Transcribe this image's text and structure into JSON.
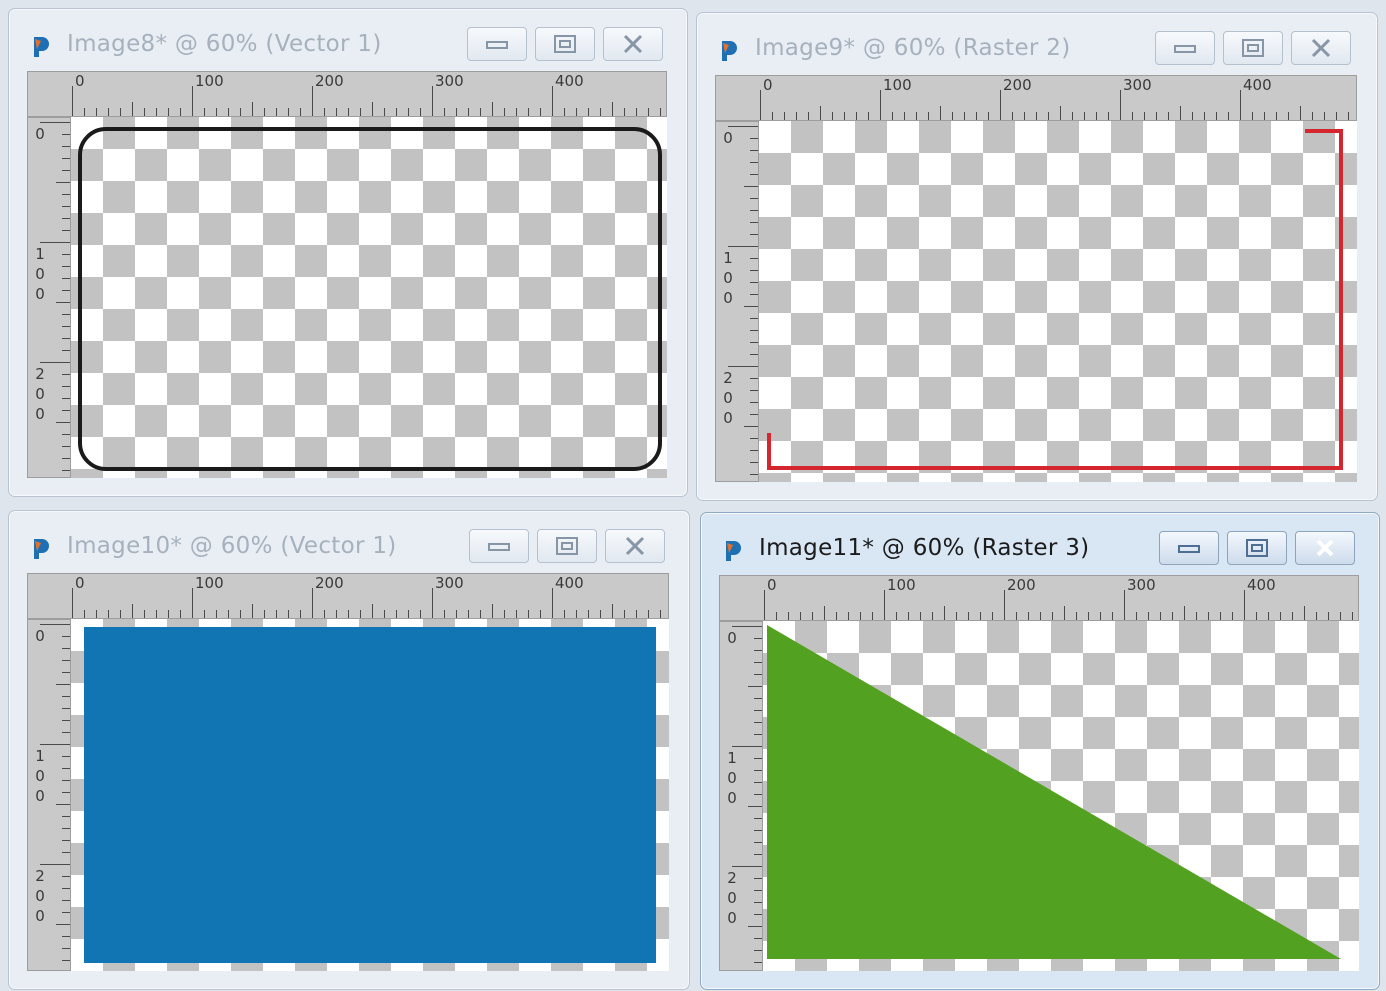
{
  "ruler": {
    "h_labels": [
      "0",
      "100",
      "200",
      "300",
      "400"
    ],
    "v_labels": [
      "0",
      "100",
      "200"
    ]
  },
  "windows": [
    {
      "title": "Image8* @ 60% (Vector 1)",
      "active": false,
      "content": "rounded-rectangle-outline",
      "color": "#1a1a1a"
    },
    {
      "title": "Image9* @ 60% (Raster 2)",
      "active": false,
      "content": "red-line",
      "color": "#d3262e"
    },
    {
      "title": "Image10* @ 60% (Vector 1)",
      "active": false,
      "content": "blue-rectangle",
      "color": "#1175b3"
    },
    {
      "title": "Image11* @ 60% (Raster 3)",
      "active": true,
      "content": "green-triangle",
      "color": "#53a120"
    }
  ],
  "icons": {
    "app": "paintshop-icon",
    "minimize": "minimize-icon",
    "maximize": "maximize-icon",
    "close": "close-icon"
  }
}
